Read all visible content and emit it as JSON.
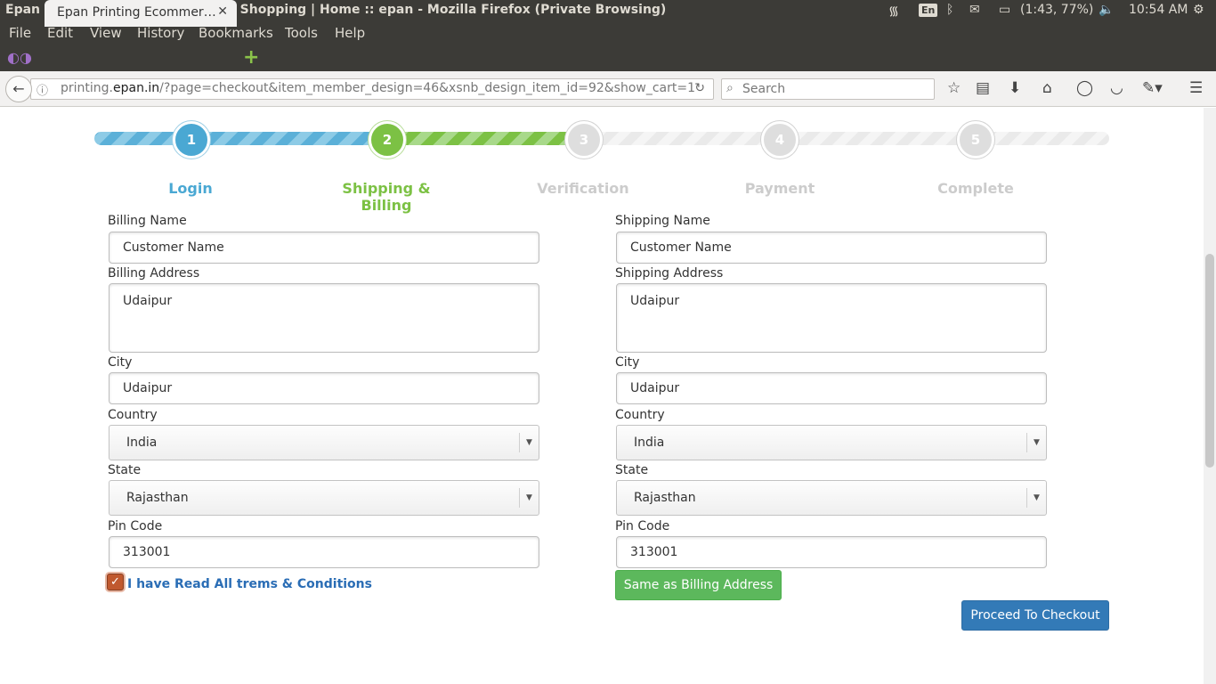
{
  "os_panel": {
    "window_title": "Epan Printing Ecommerce Online Shopping | Home :: epan - Mozilla Firefox (Private Browsing)",
    "keyboard_layout": "En",
    "battery": "(1:43, 77%)",
    "clock": "10:54 AM"
  },
  "menu": [
    "File",
    "Edit",
    "View",
    "History",
    "Bookmarks",
    "Tools",
    "Help"
  ],
  "tab": {
    "title": "Epan Printing Ecommer…",
    "close": "✕"
  },
  "url": {
    "prefix": "printing.",
    "domain": "epan.in",
    "rest": "/?page=checkout&item_member_design=46&xsnb_design_item_id=92&show_cart=1"
  },
  "search": {
    "placeholder": "Search"
  },
  "steps": [
    {
      "number": "1",
      "label": "Login",
      "state": "done"
    },
    {
      "number": "2",
      "label": "Shipping & Billing",
      "state": "active"
    },
    {
      "number": "3",
      "label": "Verification",
      "state": "pending"
    },
    {
      "number": "4",
      "label": "Payment",
      "state": "pending"
    },
    {
      "number": "5",
      "label": "Complete",
      "state": "pending"
    }
  ],
  "billing": {
    "name_label": "Billing Name",
    "name": "Customer Name",
    "address_label": "Billing Address",
    "address": "Udaipur",
    "city_label": "City",
    "city": "Udaipur",
    "country_label": "Country",
    "country": "India",
    "state_label": "State",
    "state": "Rajasthan",
    "pin_label": "Pin Code",
    "pin": "313001"
  },
  "shipping": {
    "name_label": "Shipping Name",
    "name": "Customer Name",
    "address_label": "Shipping Address",
    "address": "Udaipur",
    "city_label": "City",
    "city": "Udaipur",
    "country_label": "Country",
    "country": "India",
    "state_label": "State",
    "state": "Rajasthan",
    "pin_label": "Pin Code",
    "pin": "313001"
  },
  "terms_label": "I have Read All trems & Conditions",
  "terms_checked": true,
  "same_as_billing_label": "Same as Billing Address",
  "proceed_label": "Proceed To Checkout",
  "colors": {
    "step_done": "#4aa8d3",
    "step_active": "#7cc144",
    "step_pending": "#dedede",
    "primary_button": "#337ab7",
    "success_button": "#5cb85c"
  }
}
